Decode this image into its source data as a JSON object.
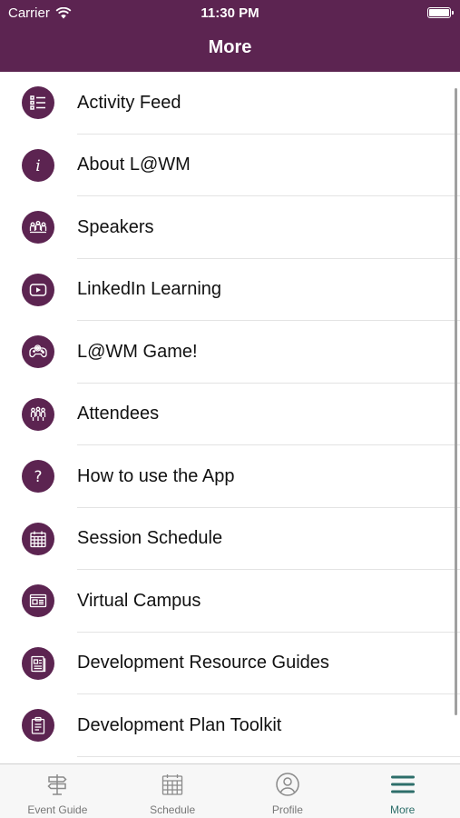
{
  "status_bar": {
    "carrier": "Carrier",
    "time": "11:30 PM"
  },
  "header": {
    "title": "More"
  },
  "menu": {
    "items": [
      {
        "label": "Activity Feed",
        "icon": "activity-feed-icon"
      },
      {
        "label": "About L@WM",
        "icon": "info-icon"
      },
      {
        "label": "Speakers",
        "icon": "speakers-icon"
      },
      {
        "label": "LinkedIn Learning",
        "icon": "video-play-icon"
      },
      {
        "label": "L@WM Game!",
        "icon": "game-controller-icon"
      },
      {
        "label": "Attendees",
        "icon": "attendees-icon"
      },
      {
        "label": "How to use the App",
        "icon": "question-icon"
      },
      {
        "label": "Session Schedule",
        "icon": "calendar-icon"
      },
      {
        "label": "Virtual Campus",
        "icon": "browser-window-icon"
      },
      {
        "label": "Development Resource Guides",
        "icon": "guide-book-icon"
      },
      {
        "label": "Development Plan Toolkit",
        "icon": "clipboard-icon"
      }
    ]
  },
  "tab_bar": {
    "tabs": [
      {
        "label": "Event Guide",
        "icon": "signpost-icon",
        "active": false
      },
      {
        "label": "Schedule",
        "icon": "calendar-icon",
        "active": false
      },
      {
        "label": "Profile",
        "icon": "profile-icon",
        "active": false
      },
      {
        "label": "More",
        "icon": "hamburger-menu-icon",
        "active": true
      }
    ]
  },
  "colors": {
    "brand": "#5c2451",
    "tab_active": "#2d6e6a",
    "tab_inactive": "#777777"
  }
}
